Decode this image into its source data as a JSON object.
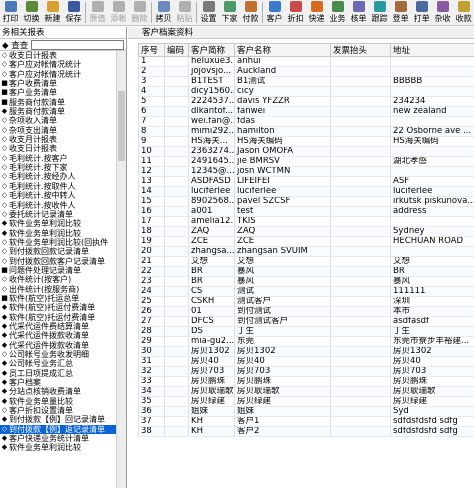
{
  "toolbar": [
    {
      "label": "打印",
      "icon": "print-icon",
      "disabled": false,
      "color": "#4a7ab5"
    },
    {
      "label": "切换",
      "icon": "switch-icon",
      "disabled": false,
      "color": "#5a8a3a"
    },
    {
      "label": "新建",
      "icon": "new-icon",
      "disabled": false,
      "color": "#d8a030"
    },
    {
      "label": "保存",
      "icon": "save-icon",
      "disabled": false,
      "color": "#3a5aa0"
    },
    {
      "sep": true
    },
    {
      "label": "原值",
      "icon": "restore-icon",
      "disabled": true,
      "color": "#b0b0b0"
    },
    {
      "label": "添帐",
      "icon": "add-entry-icon",
      "disabled": true,
      "color": "#b0b0b0"
    },
    {
      "label": "删除",
      "icon": "delete-icon",
      "disabled": true,
      "color": "#b0b0b0"
    },
    {
      "sep": true
    },
    {
      "label": "拷贝",
      "icon": "copy-icon",
      "disabled": false,
      "color": "#6a8ac0"
    },
    {
      "label": "粘贴",
      "icon": "paste-icon",
      "disabled": true,
      "color": "#b0b0b0"
    },
    {
      "sep": true
    },
    {
      "label": "设置",
      "icon": "settings-icon",
      "disabled": false,
      "color": "#7a7a7a"
    },
    {
      "label": "下家",
      "icon": "next-party-icon",
      "disabled": false,
      "color": "#4a9a6a"
    },
    {
      "label": "付款",
      "icon": "payment-icon",
      "disabled": false,
      "color": "#c07030"
    },
    {
      "sep": true
    },
    {
      "label": "客户",
      "icon": "customer-icon",
      "disabled": false,
      "color": "#3a7ac8"
    },
    {
      "label": "折扣",
      "icon": "discount-icon",
      "disabled": false,
      "color": "#c84a4a"
    },
    {
      "label": "快递",
      "icon": "express-icon",
      "disabled": false,
      "color": "#d86a20"
    },
    {
      "label": "业务",
      "icon": "business-icon",
      "disabled": false,
      "color": "#4a8a4a"
    },
    {
      "label": "核单",
      "icon": "verify-icon",
      "disabled": false,
      "color": "#6a6ab0"
    },
    {
      "label": "跟踪",
      "icon": "track-icon",
      "disabled": false,
      "color": "#2a9aa0"
    },
    {
      "label": "登单",
      "icon": "register-icon",
      "disabled": false,
      "color": "#a06a3a"
    },
    {
      "label": "打单",
      "icon": "print-waybill-icon",
      "disabled": false,
      "color": "#4a6aa0"
    },
    {
      "label": "杂收",
      "icon": "misc-income-icon",
      "disabled": false,
      "color": "#8a5aa0"
    },
    {
      "label": "收款",
      "icon": "receive-icon",
      "disabled": false,
      "color": "#c0a030"
    }
  ],
  "left": {
    "header": "务相关报表",
    "search_label": "◆ 查查",
    "selected_index": 40,
    "items": [
      {
        "b": "◇",
        "t": "收支日计报表"
      },
      {
        "b": "◇",
        "t": "客户应对帐情况统计"
      },
      {
        "b": "◇",
        "t": "客户应对帐情况统计"
      },
      {
        "b": "■",
        "t": "客户收费清单"
      },
      {
        "b": "■",
        "t": "客户业务清单"
      },
      {
        "b": "■",
        "t": "服务商付款清单"
      },
      {
        "b": "◆",
        "t": "服务商付款清单"
      },
      {
        "b": "◇",
        "t": "杂项收入清单"
      },
      {
        "b": "◇",
        "t": "杂项支出清单"
      },
      {
        "b": "◇",
        "t": "收支月计报表"
      },
      {
        "b": "◇",
        "t": "收支日计报表"
      },
      {
        "b": "◇",
        "t": "毛利统计.按客户"
      },
      {
        "b": "◇",
        "t": "毛利统计.按下家"
      },
      {
        "b": "◇",
        "t": "毛利统计.按经办人"
      },
      {
        "b": "◇",
        "t": "毛利统计.按取件人"
      },
      {
        "b": "◇",
        "t": "毛利统计.按中转人"
      },
      {
        "b": "◇",
        "t": "毛利统计.按收件人"
      },
      {
        "b": "◇",
        "t": "委托统计记录清单"
      },
      {
        "b": "◆",
        "t": "软件业务单利润比较"
      },
      {
        "b": "◆",
        "t": "软件业务单利润比较"
      },
      {
        "b": "◇",
        "t": "软件业务单利润比较(回执件"
      },
      {
        "b": "◇",
        "t": "到付拨款回款记录清单"
      },
      {
        "b": "◇",
        "t": "到付拨款回款客户记录清单"
      },
      {
        "b": "■",
        "t": "问题件处理记录清单"
      },
      {
        "b": "◇",
        "t": "收件统计(按客户)"
      },
      {
        "b": "◇",
        "t": "出件统计(按服务商)"
      },
      {
        "b": "■",
        "t": "软件(航空)托运总单"
      },
      {
        "b": "◆",
        "t": "软件(航空)托运付费清单"
      },
      {
        "b": "◆",
        "t": "软件(航空)托运付费清单"
      },
      {
        "b": "◆",
        "t": "代采代运件费结算清单"
      },
      {
        "b": "◆",
        "t": "代采代运件拨款收清单"
      },
      {
        "b": "◆",
        "t": "代采代运件拨款收清单"
      },
      {
        "b": "◇",
        "t": "公司帐号业务收发明细"
      },
      {
        "b": "◆",
        "t": "公司帐号业务汇总"
      },
      {
        "b": "◆",
        "t": "员工日项提成汇总"
      },
      {
        "b": "◆",
        "t": "客户档案"
      },
      {
        "b": "◆",
        "t": "分站点核销收费清单"
      },
      {
        "b": "◆",
        "t": "软件业务单量比较"
      },
      {
        "b": "◇",
        "t": "客户折扣设置清单"
      },
      {
        "b": "◆",
        "t": "到付拨款【例】回记录清单"
      },
      {
        "b": "◇",
        "t": "到付拨款【例】返记录清单"
      },
      {
        "b": "◆",
        "t": "客户快递业务统计清单"
      },
      {
        "b": "◆",
        "t": "软件业务单利润比较"
      }
    ]
  },
  "right": {
    "tab": "客户档案资料",
    "columns": [
      "序号",
      "编码",
      "客户简称",
      "客户名称",
      "发票抬头",
      "地址"
    ],
    "rows": [
      [
        "1",
        "",
        "heluxue3...",
        "anhui",
        "",
        ""
      ],
      [
        "2",
        "",
        "jojovsjo...",
        "Auckland",
        "",
        ""
      ],
      [
        "3",
        "",
        "B1TEST",
        "B1测试",
        "",
        "BBBBB"
      ],
      [
        "4",
        "",
        "dicy1560...",
        "cicy",
        "",
        ""
      ],
      [
        "5",
        "",
        "2224537...",
        "davis YFZZR",
        "",
        "234234"
      ],
      [
        "6",
        "",
        "dlkantof...",
        "fanwei",
        "",
        "new zealand"
      ],
      [
        "7",
        "",
        "wei.fan@...",
        "fdas",
        "",
        ""
      ],
      [
        "8",
        "",
        "mimi292...",
        "hamilton",
        "",
        "22 Osborne ave ..."
      ],
      [
        "9",
        "",
        "HS海关...",
        "HS海关编码",
        "",
        "HS海关编码"
      ],
      [
        "10",
        "",
        "2363274...",
        "Jason OMOFA",
        "",
        ""
      ],
      [
        "11",
        "",
        "2491645...",
        "jie BMRSV",
        "",
        "湖北孝感"
      ],
      [
        "12",
        "",
        "12345@...",
        "josn WCTMN",
        "",
        ""
      ],
      [
        "13",
        "",
        "ASDFASD",
        "LIFEIFEI",
        "",
        "ASF"
      ],
      [
        "14",
        "",
        "luciferlee",
        "luciferlee",
        "",
        "luciferlee"
      ],
      [
        "15",
        "",
        "8902568...",
        "pavel SZCSF",
        "",
        "irkutsk piskunova..."
      ],
      [
        "16",
        "",
        "a001",
        "test",
        "",
        "address"
      ],
      [
        "17",
        "",
        "amelia12...",
        "TKIS",
        "",
        ""
      ],
      [
        "18",
        "",
        "ZAQ",
        "ZAQ",
        "",
        "Sydney"
      ],
      [
        "19",
        "",
        "ZCE",
        "ZCE",
        "",
        "HECHUAN ROAD"
      ],
      [
        "20",
        "",
        "zhangsa...",
        "zhangsan SVUIM",
        "",
        ""
      ],
      [
        "21",
        "",
        "艾想",
        "艾想",
        "",
        "艾想"
      ],
      [
        "22",
        "",
        "BR",
        "暴风",
        "",
        "BR"
      ],
      [
        "23",
        "",
        "BR",
        "暴风",
        "",
        "暴风"
      ],
      [
        "24",
        "",
        "CS",
        "测试",
        "",
        "111111"
      ],
      [
        "25",
        "",
        "CSKH",
        "测试客户",
        "",
        "深圳"
      ],
      [
        "26",
        "",
        "01",
        "到付测试",
        "",
        "本市"
      ],
      [
        "27",
        "",
        "DFCS",
        "到付测试客户",
        "",
        "asdfasdf"
      ],
      [
        "28",
        "",
        "DS",
        "丁生",
        "",
        "丁生"
      ],
      [
        "29",
        "",
        "mia-gu2...",
        "东莞",
        "",
        "东莞市寮步丰裕建..."
      ],
      [
        "30",
        "",
        "房贝1302",
        "房贝1302",
        "",
        "房贝1302"
      ],
      [
        "31",
        "",
        "房贝40",
        "房贝40",
        "",
        "房贝40"
      ],
      [
        "32",
        "",
        "房贝703",
        "房贝703",
        "",
        "房贝703"
      ],
      [
        "33",
        "",
        "房贝鹏珠",
        "房贝鹏珠",
        "",
        "房贝鹏珠"
      ],
      [
        "34",
        "",
        "房贝耿瑞歌",
        "房贝耿瑞歌",
        "",
        "房贝耿瑞歌"
      ],
      [
        "35",
        "",
        "房贝绿建",
        "房贝绿建",
        "",
        "房贝绿建"
      ],
      [
        "36",
        "",
        "姐妹",
        "姐妹",
        "",
        "Syd"
      ],
      [
        "37",
        "",
        "KH",
        "客户1",
        "",
        "sdfdsfdsfd sdfg"
      ],
      [
        "38",
        "",
        "KH",
        "客户2",
        "",
        "sdfdsfdsfd sdfg"
      ]
    ]
  }
}
